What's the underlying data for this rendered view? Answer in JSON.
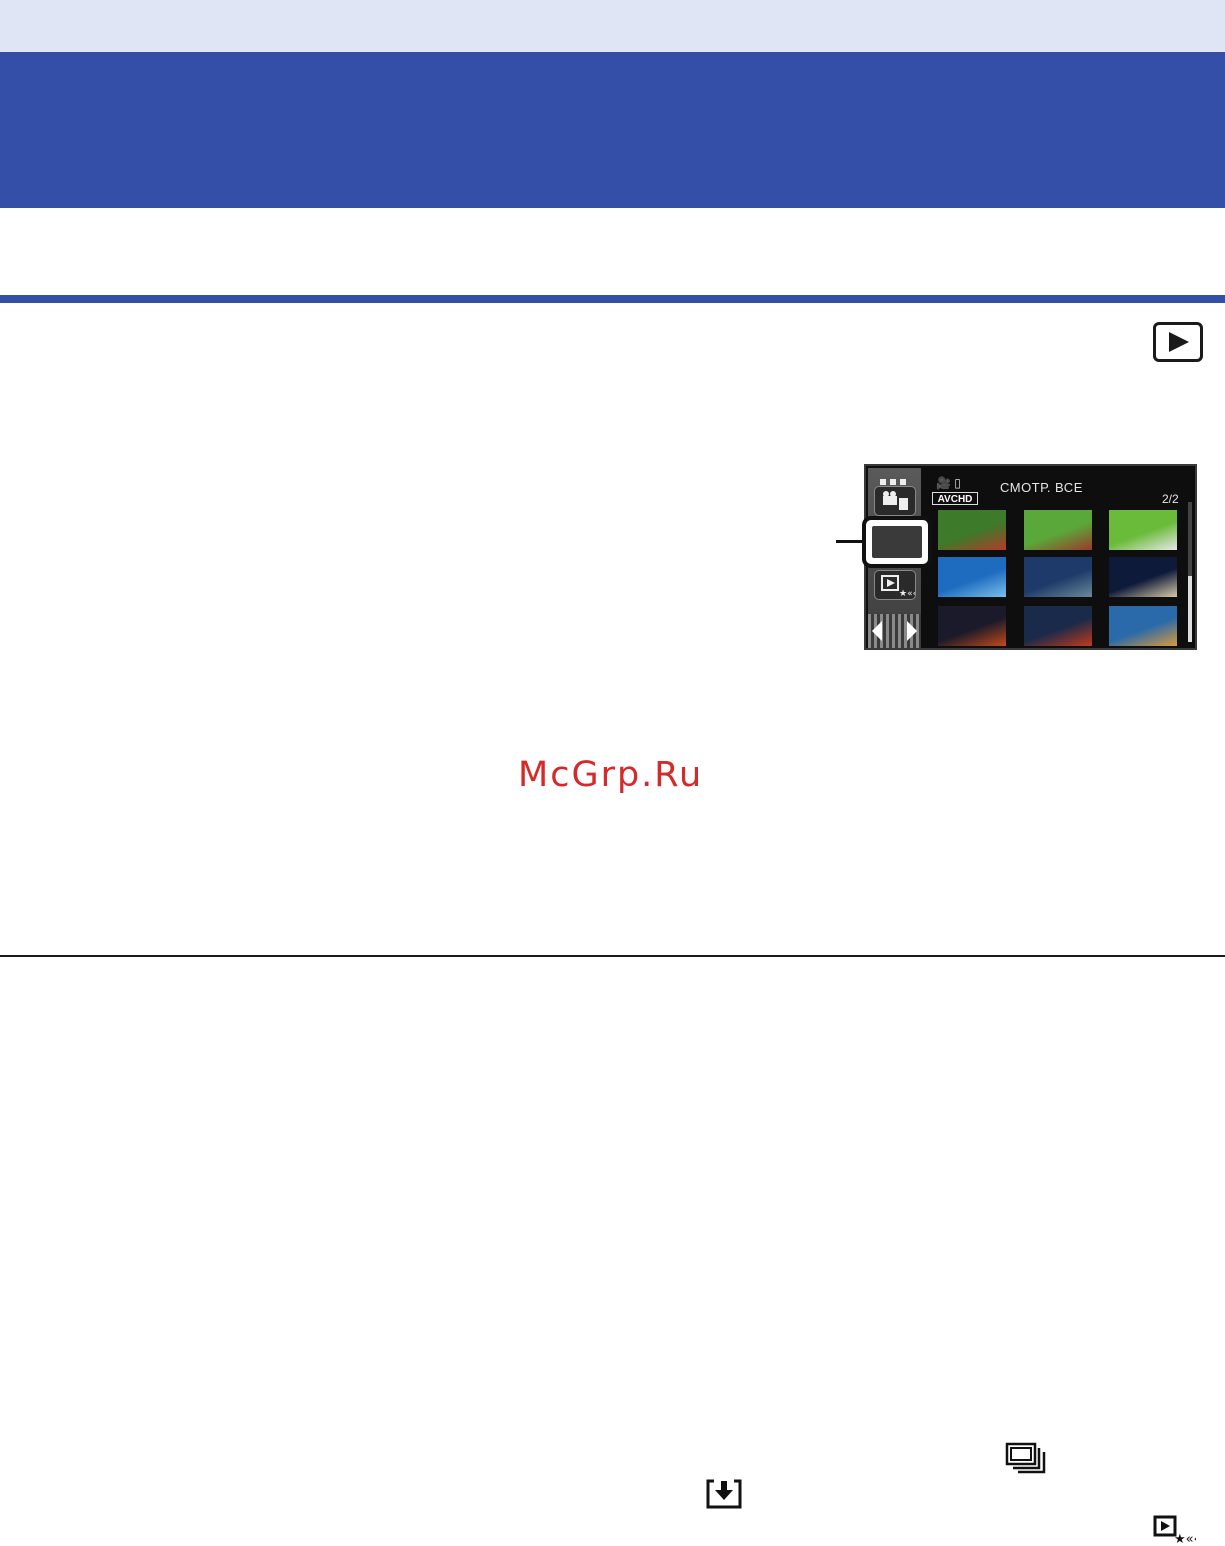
{
  "camera_screen": {
    "title": "СМОТР. ВСЕ",
    "format_badge": "AVCHD",
    "page_indicator": "2/2",
    "mode_icons": "🎥 ▯",
    "thumbnails": [
      {
        "label": "girl-on-swing",
        "color_a": "#3d7a2a",
        "color_b": "#b33a2a"
      },
      {
        "label": "red-dog",
        "color_a": "#5aa83a",
        "color_b": "#9a3a2a"
      },
      {
        "label": "white-dog",
        "color_a": "#6abb3a",
        "color_b": "#e8e8e8"
      },
      {
        "label": "underwater-ray",
        "color_a": "#1e6cbf",
        "color_b": "#7ac0ea"
      },
      {
        "label": "coral-reef",
        "color_a": "#1e3a6a",
        "color_b": "#6a8a9a"
      },
      {
        "label": "night-couple",
        "color_a": "#0e1a3a",
        "color_b": "#d8c8a8"
      },
      {
        "label": "red-temple-1",
        "color_a": "#1a1a2a",
        "color_b": "#c24a1a"
      },
      {
        "label": "red-temple-2",
        "color_a": "#1a2a4a",
        "color_b": "#c23a1a"
      },
      {
        "label": "temple-dusk",
        "color_a": "#2a6aaa",
        "color_b": "#d89a3a"
      }
    ]
  },
  "watermark": "McGrp.Ru",
  "icons": [
    "play-mode-icon",
    "multi-frame-icon",
    "save-down-icon",
    "highlight-play-icon"
  ]
}
